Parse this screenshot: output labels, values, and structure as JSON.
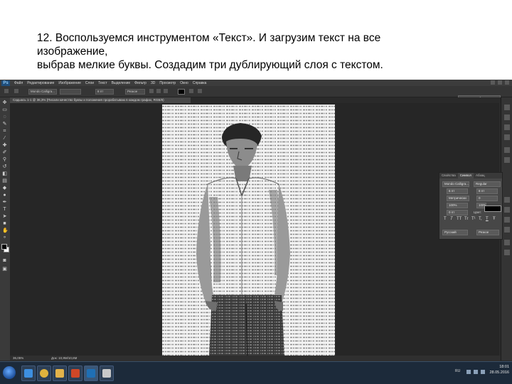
{
  "slide": {
    "lines": [
      "12. Воспользуемся инструментом «Текст». И загрузим текст  на все",
      "изображение,",
      "выбрав мелкие буквы.  Создадим три дублирующий слоя с текстом."
    ]
  },
  "photoshop": {
    "logo": "Ps",
    "menu": [
      "Файл",
      "Редактирование",
      "Изображение",
      "Слои",
      "Текст",
      "Выделение",
      "Фильтр",
      "3D",
      "Просмотр",
      "Окно",
      "Справка"
    ],
    "options": {
      "font_family": "Mondo Calligra...",
      "font_size": "8 пт",
      "anti_alias": "Резкое",
      "text_color": "#000000"
    },
    "workspace": "Основная рабочая среда",
    "doc_tab": "Садьюсь 1-1 @ 36,3% (Писали качество буквы и положения прорабатываю в каждом графах, RGB/8)",
    "status": {
      "zoom": "36,05%",
      "doc_size": "Док: 10,9М/10,6М"
    },
    "character_panel": {
      "tabs": [
        "Свойства",
        "Символ",
        "Абзац"
      ],
      "active_tab": "Символ",
      "font_family": "Mondo Calligra...",
      "font_style": "Regular",
      "font_size": "6 пт",
      "leading": "8 пт",
      "kerning": "Метрически",
      "tracking": "0",
      "vscale": "100%",
      "hscale": "100%",
      "baseline": "0 пт",
      "color_label": "Цвет:",
      "glyphs": [
        "T",
        "T",
        "TT",
        "Tr",
        "T¹",
        "T,",
        "T",
        "Ŧ"
      ],
      "language": "Русский",
      "aa_mode": "Резкое"
    }
  },
  "taskbar": {
    "time": "18:01",
    "date": "28.05.2016",
    "lang": "RU",
    "apps": [
      {
        "name": "ie",
        "color": "#3d8fe0"
      },
      {
        "name": "chrome",
        "color": "#e0b33d"
      },
      {
        "name": "folder",
        "color": "#e3b24a"
      },
      {
        "name": "powerpoint",
        "color": "#d04727"
      },
      {
        "name": "word",
        "color": "#2b5fb3"
      },
      {
        "name": "photoshop",
        "color": "#1f6fb5"
      },
      {
        "name": "files",
        "color": "#c9c9c9"
      }
    ]
  }
}
